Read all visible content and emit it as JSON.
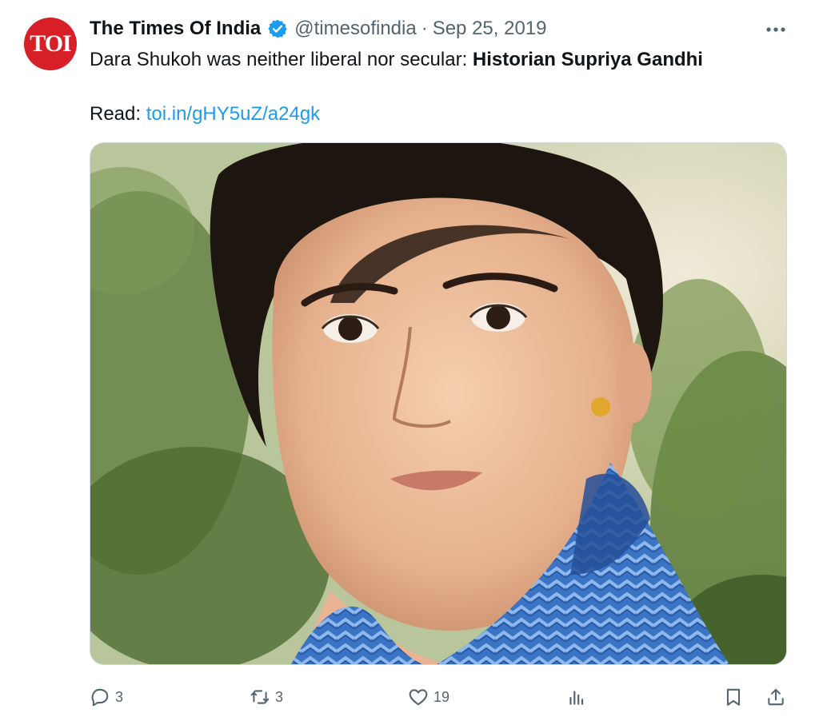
{
  "tweet": {
    "author": {
      "display_name": "The Times Of India",
      "handle": "@timesofindia",
      "avatar_text": "TOI",
      "verified": true
    },
    "separator": "·",
    "date": "Sep 25, 2019",
    "text_plain": "Dara Shukoh was neither liberal nor secular: ",
    "text_bold": "Historian Supriya Gandhi",
    "read_label": "Read: ",
    "link_text": "toi.in/gHY5uZ/a24gk",
    "more_icon": "more-horizontal-icon",
    "media": {
      "subject": "photo-portrait"
    },
    "actions": {
      "reply_count": "3",
      "retweet_count": "3",
      "like_count": "19"
    }
  },
  "colors": {
    "text_primary": "#0f1419",
    "text_secondary": "#536471",
    "link": "#1d9bf0",
    "verified": "#1d9bf0",
    "avatar_bg": "#d71f27"
  }
}
